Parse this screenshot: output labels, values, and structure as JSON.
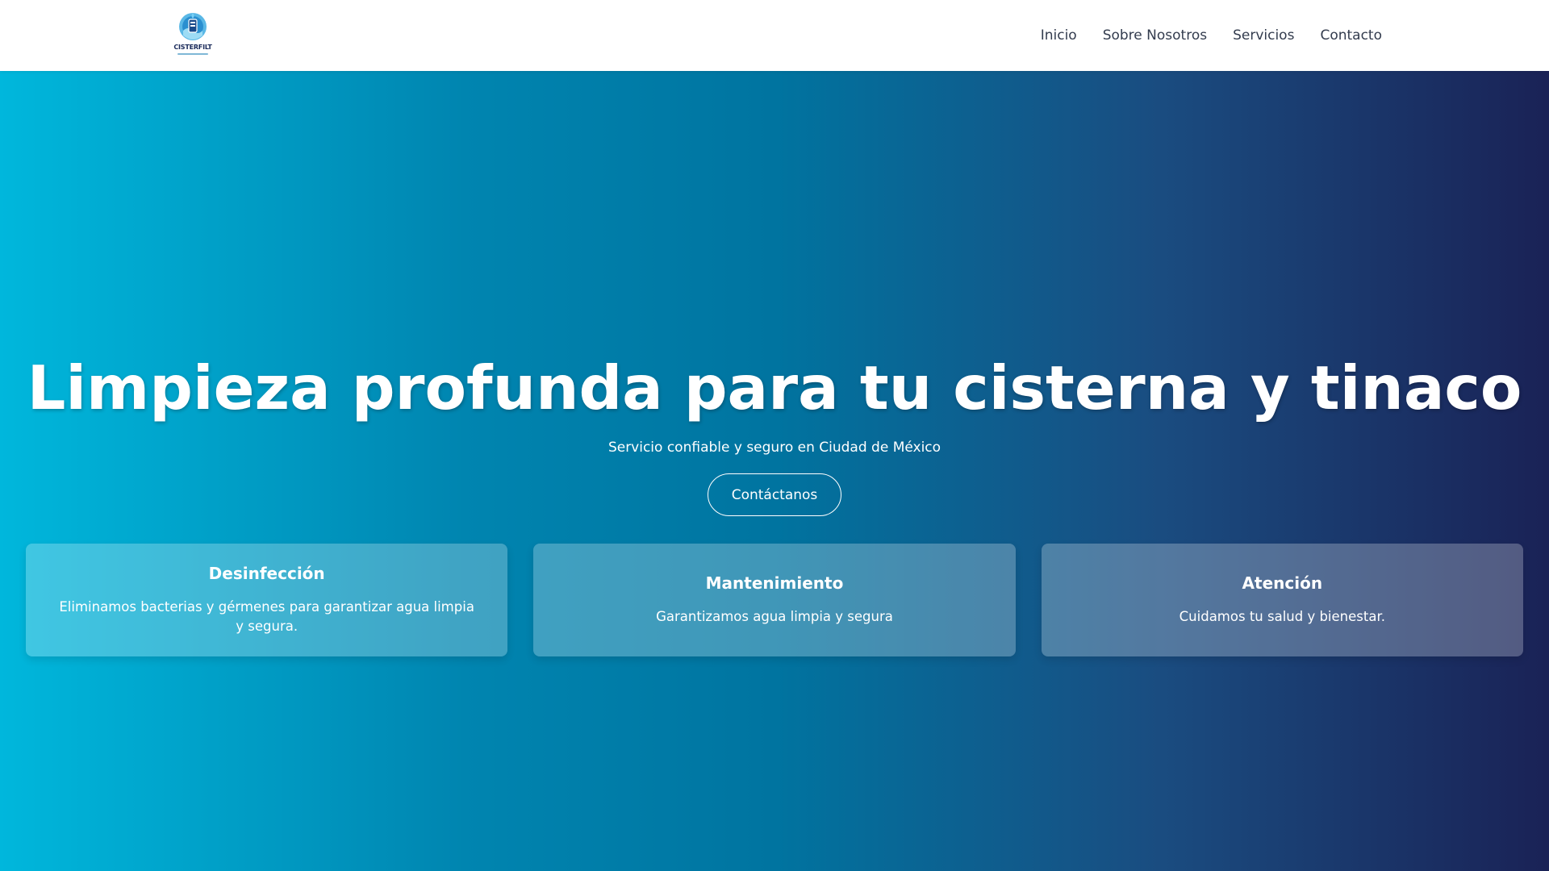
{
  "brand": {
    "logo_text": "CISTERFILT",
    "logo_icon": "water-drop-logo"
  },
  "nav": {
    "items": [
      {
        "label": "Inicio"
      },
      {
        "label": "Sobre Nosotros"
      },
      {
        "label": "Servicios"
      },
      {
        "label": "Contacto"
      }
    ]
  },
  "hero": {
    "title": "Limpieza profunda para tu cisterna y tinaco",
    "subtitle": "Servicio confiable y seguro en Ciudad de México",
    "cta_label": "Contáctanos",
    "gradient_colors": [
      "#00b7dc",
      "#0074a0",
      "#1a2256"
    ]
  },
  "features": [
    {
      "title": "Desinfección",
      "text": "Eliminamos bacterias y gérmenes para garantizar agua limpia y segura."
    },
    {
      "title": "Mantenimiento",
      "text": "Garantizamos agua limpia y segura"
    },
    {
      "title": "Atención",
      "text": "Cuidamos tu salud y bienestar."
    }
  ]
}
